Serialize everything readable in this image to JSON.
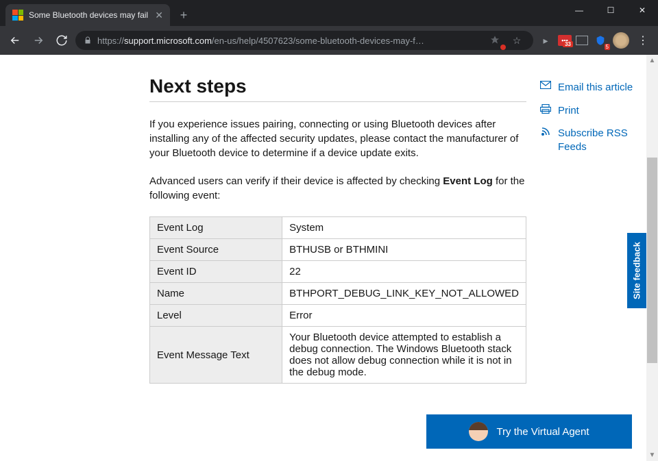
{
  "browser": {
    "tab_title": "Some Bluetooth devices may fail",
    "url_proto": "https://",
    "url_host": "support.microsoft.com",
    "url_path": "/en-us/help/4507623/some-bluetooth-devices-may-f…",
    "ext_badge_1": "33",
    "ext_badge_2": "5"
  },
  "article": {
    "heading": "Next steps",
    "para1": "If you experience issues pairing, connecting or using Bluetooth devices after installing any of the affected security updates, please contact the manufacturer of your Bluetooth device to determine if a device update exits.",
    "para2_pre": "Advanced users can verify if their device is affected by checking ",
    "para2_bold": "Event Log",
    "para2_post": " for the following event:",
    "table": [
      {
        "k": "Event Log",
        "v": "System"
      },
      {
        "k": "Event Source",
        "v": "BTHUSB or BTHMINI"
      },
      {
        "k": "Event ID",
        "v": "22"
      },
      {
        "k": "Name",
        "v": "BTHPORT_DEBUG_LINK_KEY_NOT_ALLOWED"
      },
      {
        "k": "Level",
        "v": "Error"
      },
      {
        "k": "Event Message Text",
        "v": "Your Bluetooth device attempted to establish a debug connection.  The Windows Bluetooth stack does not allow debug connection while it is not in the debug mode."
      }
    ]
  },
  "sidebar": {
    "email": "Email this article",
    "print": "Print",
    "rss": "Subscribe RSS Feeds"
  },
  "virtual_agent": "Try the Virtual Agent",
  "feedback": "Site feedback"
}
